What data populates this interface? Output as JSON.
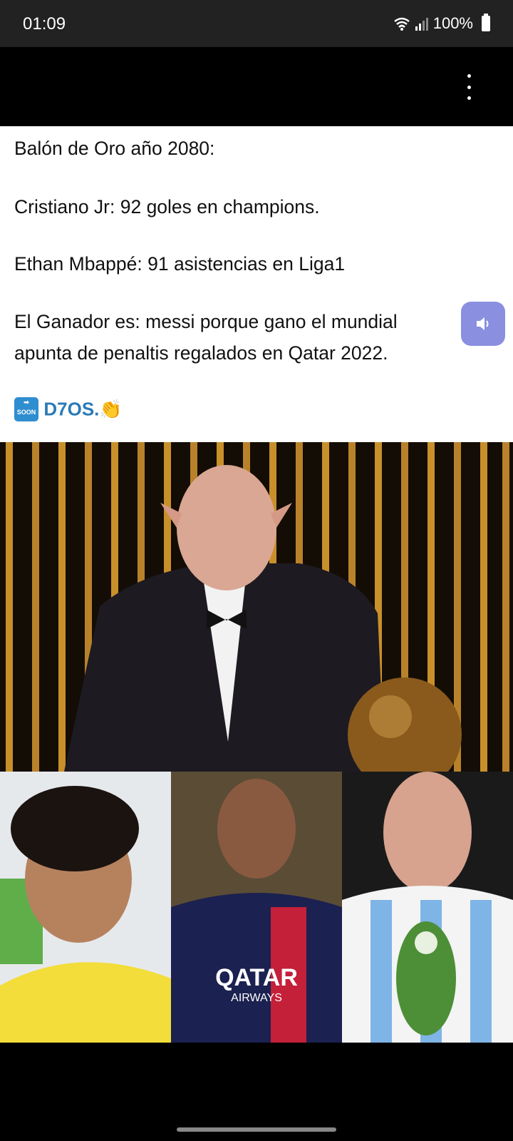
{
  "status_bar": {
    "time": "01:09",
    "battery": "100%",
    "icons": [
      "wifi-icon",
      "signal-icon",
      "battery-icon"
    ]
  },
  "app_bar": {
    "menu_icon": "more-vert-icon"
  },
  "post": {
    "lines": [
      "Balón de Oro año 2080:",
      "Cristiano Jr: 92 goles en champions.",
      "Ethan Mbappé: 91 asistencias en Liga1",
      "El Ganador es: messi porque gano el mundial",
      "apunta de penaltis regalados en Qatar 2022."
    ],
    "soon_label": "SOON",
    "tag": "D7OS.",
    "speaker_icon": "speaker-icon"
  },
  "image": {
    "jersey_sponsor": "QATAR",
    "jersey_sponsor_sub": "AIRWAYS",
    "colors": {
      "background": "#000000",
      "post": "#ffffff",
      "accent": "#8a8fe0"
    }
  }
}
